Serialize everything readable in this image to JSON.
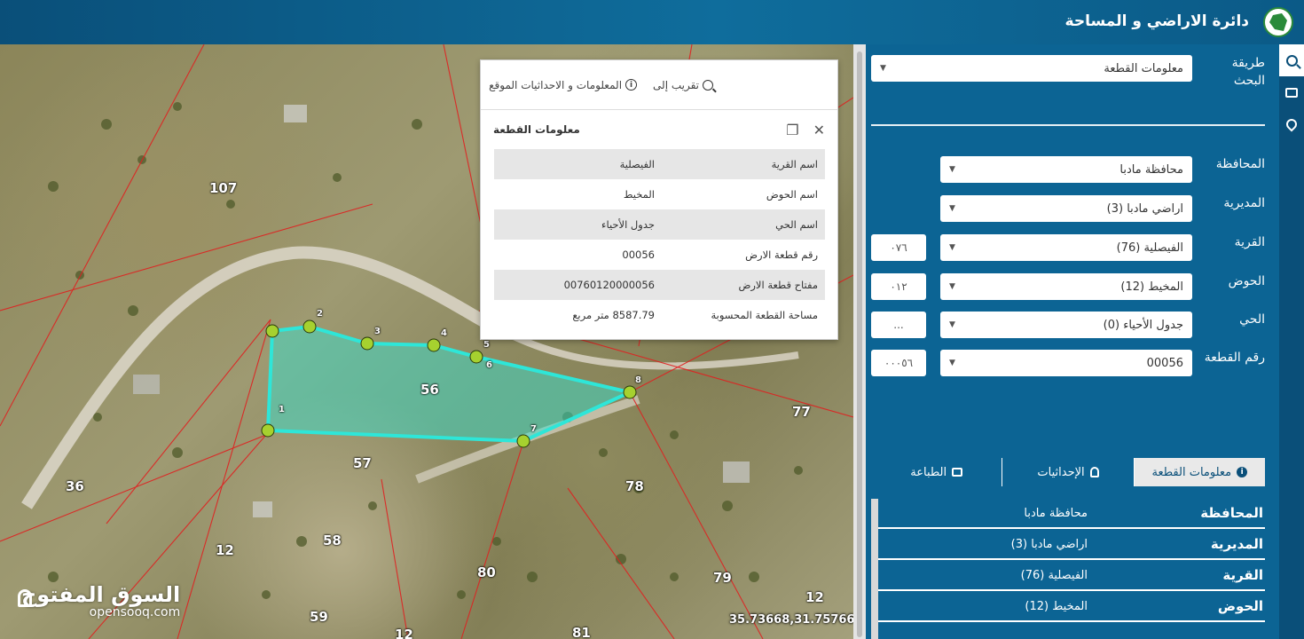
{
  "header": {
    "title": "دائرة الاراضي و المساحة"
  },
  "map": {
    "parcel_numbers": [
      {
        "label": "107"
      },
      {
        "label": "56"
      },
      {
        "label": "57"
      },
      {
        "label": "36"
      },
      {
        "label": "78"
      },
      {
        "label": "58"
      },
      {
        "label": "12"
      },
      {
        "label": "80"
      },
      {
        "label": "79"
      },
      {
        "label": "12"
      },
      {
        "label": "59"
      },
      {
        "label": "12"
      },
      {
        "label": "81"
      },
      {
        "label": "77"
      }
    ],
    "vertex_labels": [
      "1",
      "2",
      "3",
      "4",
      "5",
      "6",
      "7",
      "8"
    ],
    "coordinates": "35.73668,31.75766",
    "watermark_ar": "السوق المفتوح",
    "watermark_en": "opensooq.com",
    "parcel_color": "#2ee6d8"
  },
  "popup": {
    "tool_info": "المعلومات و الاحداثيات الموقع",
    "tool_zoom": "تقريب إلى",
    "title": "معلومات القطعة",
    "rows": [
      {
        "key": "اسم القرية",
        "value": "الفيصلية"
      },
      {
        "key": "اسم الحوض",
        "value": "المخيط"
      },
      {
        "key": "اسم الحي",
        "value": "جدول الأحياء"
      },
      {
        "key": "رقم قطعة الارض",
        "value": "00056"
      },
      {
        "key": "مفتاح قطعة الارض",
        "value": "00760120000056"
      },
      {
        "key": "مساحة القطعة المحسوبة",
        "value": "8587.79 متر مربع"
      }
    ]
  },
  "sidebar": {
    "search_method_label": "طريقة البحث",
    "search_method_value": "معلومات القطعة",
    "fields": [
      {
        "label": "المحافظة",
        "value": "محافظة مادبا",
        "code": ""
      },
      {
        "label": "المديرية",
        "value": "اراضي مادبا (3)",
        "code": ""
      },
      {
        "label": "القرية",
        "value": "الفيصلية (76)",
        "code": "٠٧٦"
      },
      {
        "label": "الحوض",
        "value": "المخيط (12)",
        "code": "٠١٢"
      },
      {
        "label": "الحي",
        "value": "جدول الأحياء (0)",
        "code": "..."
      },
      {
        "label": "رقم القطعة",
        "value": "00056",
        "code": "٠٠٠٥٦"
      }
    ],
    "tabs": [
      "معلومات القطعة",
      "الإحداثيات",
      "الطباعة"
    ],
    "info_rows": [
      {
        "key": "المحافظة",
        "value": "محافظة مادبا"
      },
      {
        "key": "المديرية",
        "value": "اراضي مادبا (3)"
      },
      {
        "key": "القرية",
        "value": "الفيصلية (76)"
      },
      {
        "key": "الحوض",
        "value": "المخيط (12)"
      }
    ]
  }
}
